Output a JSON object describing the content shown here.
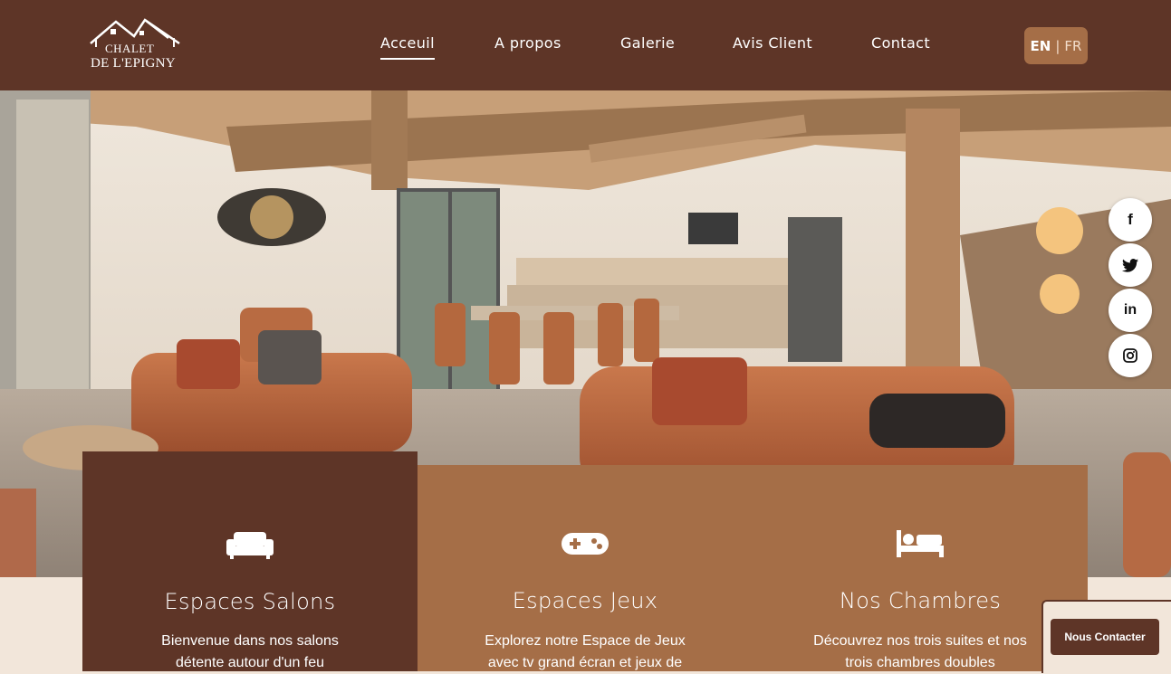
{
  "brand": {
    "line1": "CHALET",
    "line2": "DE L'EPIGNY"
  },
  "nav": {
    "items": [
      {
        "label": "Acceuil",
        "active": true
      },
      {
        "label": "A propos"
      },
      {
        "label": "Galerie"
      },
      {
        "label": "Avis Client"
      },
      {
        "label": "Contact"
      }
    ]
  },
  "lang": {
    "en": "EN",
    "sep": "|",
    "fr": "FR"
  },
  "hero": {
    "image": "chalet-living-room-photo"
  },
  "social": [
    {
      "icon": "facebook-icon",
      "glyph": "f"
    },
    {
      "icon": "twitter-icon",
      "glyph": "t"
    },
    {
      "icon": "linkedin-icon",
      "glyph": "in"
    },
    {
      "icon": "instagram-icon",
      "glyph": "ig"
    }
  ],
  "features": [
    {
      "icon": "sofa-icon",
      "title": "Espaces Salons",
      "text": "Bienvenue dans nos salons détente autour d'un feu"
    },
    {
      "icon": "gamepad-icon",
      "title": "Espaces Jeux",
      "text": "Explorez notre Espace de Jeux avec tv grand écran et jeux de"
    },
    {
      "icon": "bed-icon",
      "title": "Nos Chambres",
      "text": "Découvrez nos trois suites et nos trois chambres doubles"
    }
  ],
  "contact_button": "Nous Contacter",
  "colors": {
    "brown_dark": "#5e3527",
    "brown_light": "#a56e47",
    "cream": "#f2e6da"
  }
}
